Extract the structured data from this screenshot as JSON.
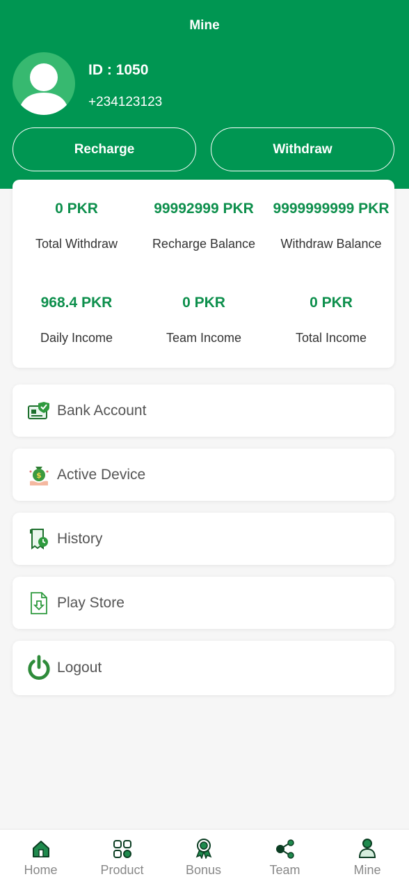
{
  "header": {
    "title": "Mine",
    "user_id": "ID : 1050",
    "phone": "+234123123",
    "recharge_label": "Recharge",
    "withdraw_label": "Withdraw"
  },
  "stats": [
    {
      "value": "0 PKR",
      "label": "Total Withdraw"
    },
    {
      "value": "99992999 PKR",
      "label": "Recharge Balance"
    },
    {
      "value": "9999999999 PKR",
      "label": "Withdraw Balance"
    },
    {
      "value": "968.4 PKR",
      "label": "Daily Income"
    },
    {
      "value": "0 PKR",
      "label": "Team Income"
    },
    {
      "value": "0 PKR",
      "label": "Total Income"
    }
  ],
  "menu": [
    {
      "label": "Bank Account",
      "icon": "bank-card-icon"
    },
    {
      "label": "Active Device",
      "icon": "money-bag-hand-icon"
    },
    {
      "label": "History",
      "icon": "history-receipt-icon"
    },
    {
      "label": "Play Store",
      "icon": "download-file-icon"
    },
    {
      "label": "Logout",
      "icon": "power-icon"
    }
  ],
  "tabs": [
    {
      "label": "Home",
      "icon": "home-icon"
    },
    {
      "label": "Product",
      "icon": "grid-icon"
    },
    {
      "label": "Bonus",
      "icon": "award-icon"
    },
    {
      "label": "Team",
      "icon": "share-icon"
    },
    {
      "label": "Mine",
      "icon": "user-icon"
    }
  ],
  "colors": {
    "brand": "#009652",
    "value_green": "#0d8f4c",
    "background": "#f6f6f6"
  }
}
